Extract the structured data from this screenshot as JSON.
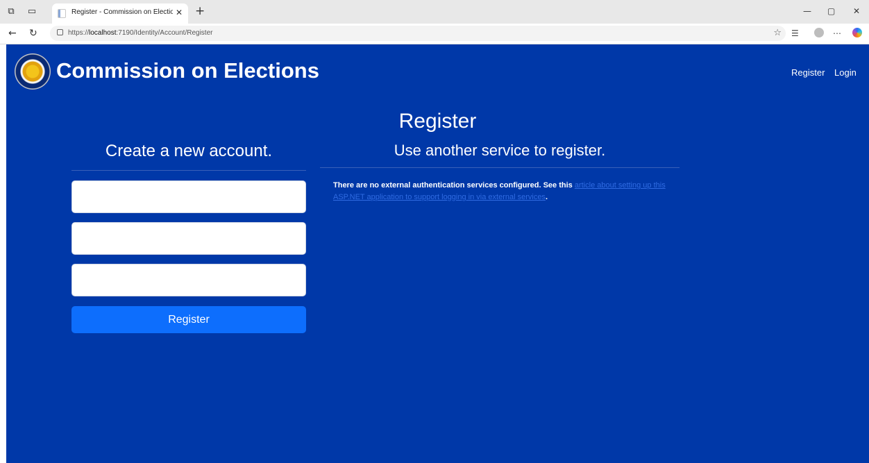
{
  "browser": {
    "tab_title": "Register - Commission on Electio",
    "url_prefix": "https://",
    "url_host": "localhost",
    "url_path": ":7190/Identity/Account/Register"
  },
  "header": {
    "brand": "Commission on Elections",
    "nav": [
      "Register",
      "Login"
    ]
  },
  "main": {
    "page_title": "Register",
    "create_title": "Create a new account.",
    "external_title": "Use another service to register.",
    "register_button": "Register",
    "external_info_text": "There are no external authentication services configured. See this ",
    "external_info_link": "article about setting up this ASP.NET application to support logging in via external services",
    "external_info_end": "."
  },
  "fields": [
    {
      "value": "",
      "placeholder": ""
    },
    {
      "value": "",
      "placeholder": ""
    },
    {
      "value": "",
      "placeholder": ""
    }
  ],
  "icons": {
    "tab_actions": "tab-actions-icon",
    "vertical_tabs": "vertical-tabs-icon",
    "favicon": "page-favicon-icon",
    "close": "close-icon",
    "new_tab": "plus-icon",
    "back": "back-arrow-icon",
    "refresh": "refresh-icon",
    "lock": "lock-icon",
    "favorite": "star-icon",
    "favorites_list": "favorites-icon",
    "profile": "profile-icon",
    "menu": "more-icon",
    "copilot": "copilot-icon",
    "logo": "comelec-seal-icon"
  },
  "colors": {
    "page_background": "#0038a8",
    "button": "#0d6efd",
    "link": "#2f6be2"
  }
}
